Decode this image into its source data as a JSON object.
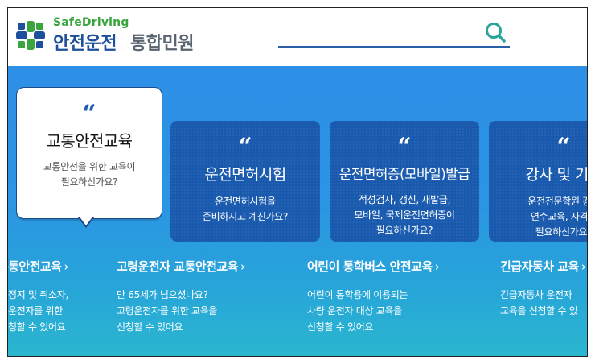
{
  "header": {
    "logo_en": "SafeDriving",
    "logo_ko": "안전운전",
    "logo_sub": "통합민원",
    "search_placeholder": ""
  },
  "colors": {
    "brand_blue": "#1d4f9c",
    "brand_green": "#3aa53f",
    "hero_top": "#2d8fe6",
    "hero_bottom": "#2bb7cf",
    "card_dark": "#1a5aae"
  },
  "cards": [
    {
      "quote": "“",
      "title": "교통안전교육",
      "desc": [
        "교통안전을 위한 교육이",
        "필요하신가요?"
      ]
    },
    {
      "quote": "“",
      "title": "운전면허시험",
      "desc": [
        "운전면허시험을",
        "준비하시고 계신가요?"
      ]
    },
    {
      "quote": "“",
      "title": "운전면허증(모바일)발급",
      "desc": [
        "적성검사, 갱신, 재발급,",
        "모바일, 국제운전면허증이",
        "필요하신가요?"
      ]
    },
    {
      "quote": "“",
      "title": "강사 및 기능",
      "desc": [
        "운전전문학원 강사",
        "연수교육, 자격증",
        "필요하신가요?"
      ]
    }
  ],
  "links": [
    {
      "title": "통안전교육",
      "chev": "›",
      "desc": [
        "정지 및 취소자,",
        "운전자를 위한",
        "청할 수 있어요"
      ]
    },
    {
      "title": "고령운전자 교통안전교육",
      "chev": "›",
      "desc": [
        "만 65세가 넘으셨나요?",
        "고령운전자를 위한 교육을",
        "신청할 수 있어요"
      ]
    },
    {
      "title": "어린이 통학버스 안전교육",
      "chev": "›",
      "desc": [
        "어린이 통학용에 이용되는",
        "차량 운전자 대상 교육을",
        "신청할 수 있어요"
      ]
    },
    {
      "title": "긴급자동차 교육",
      "chev": "›",
      "desc": [
        "긴급자동차 운전자",
        "교육을 신청할 수 있"
      ]
    }
  ]
}
